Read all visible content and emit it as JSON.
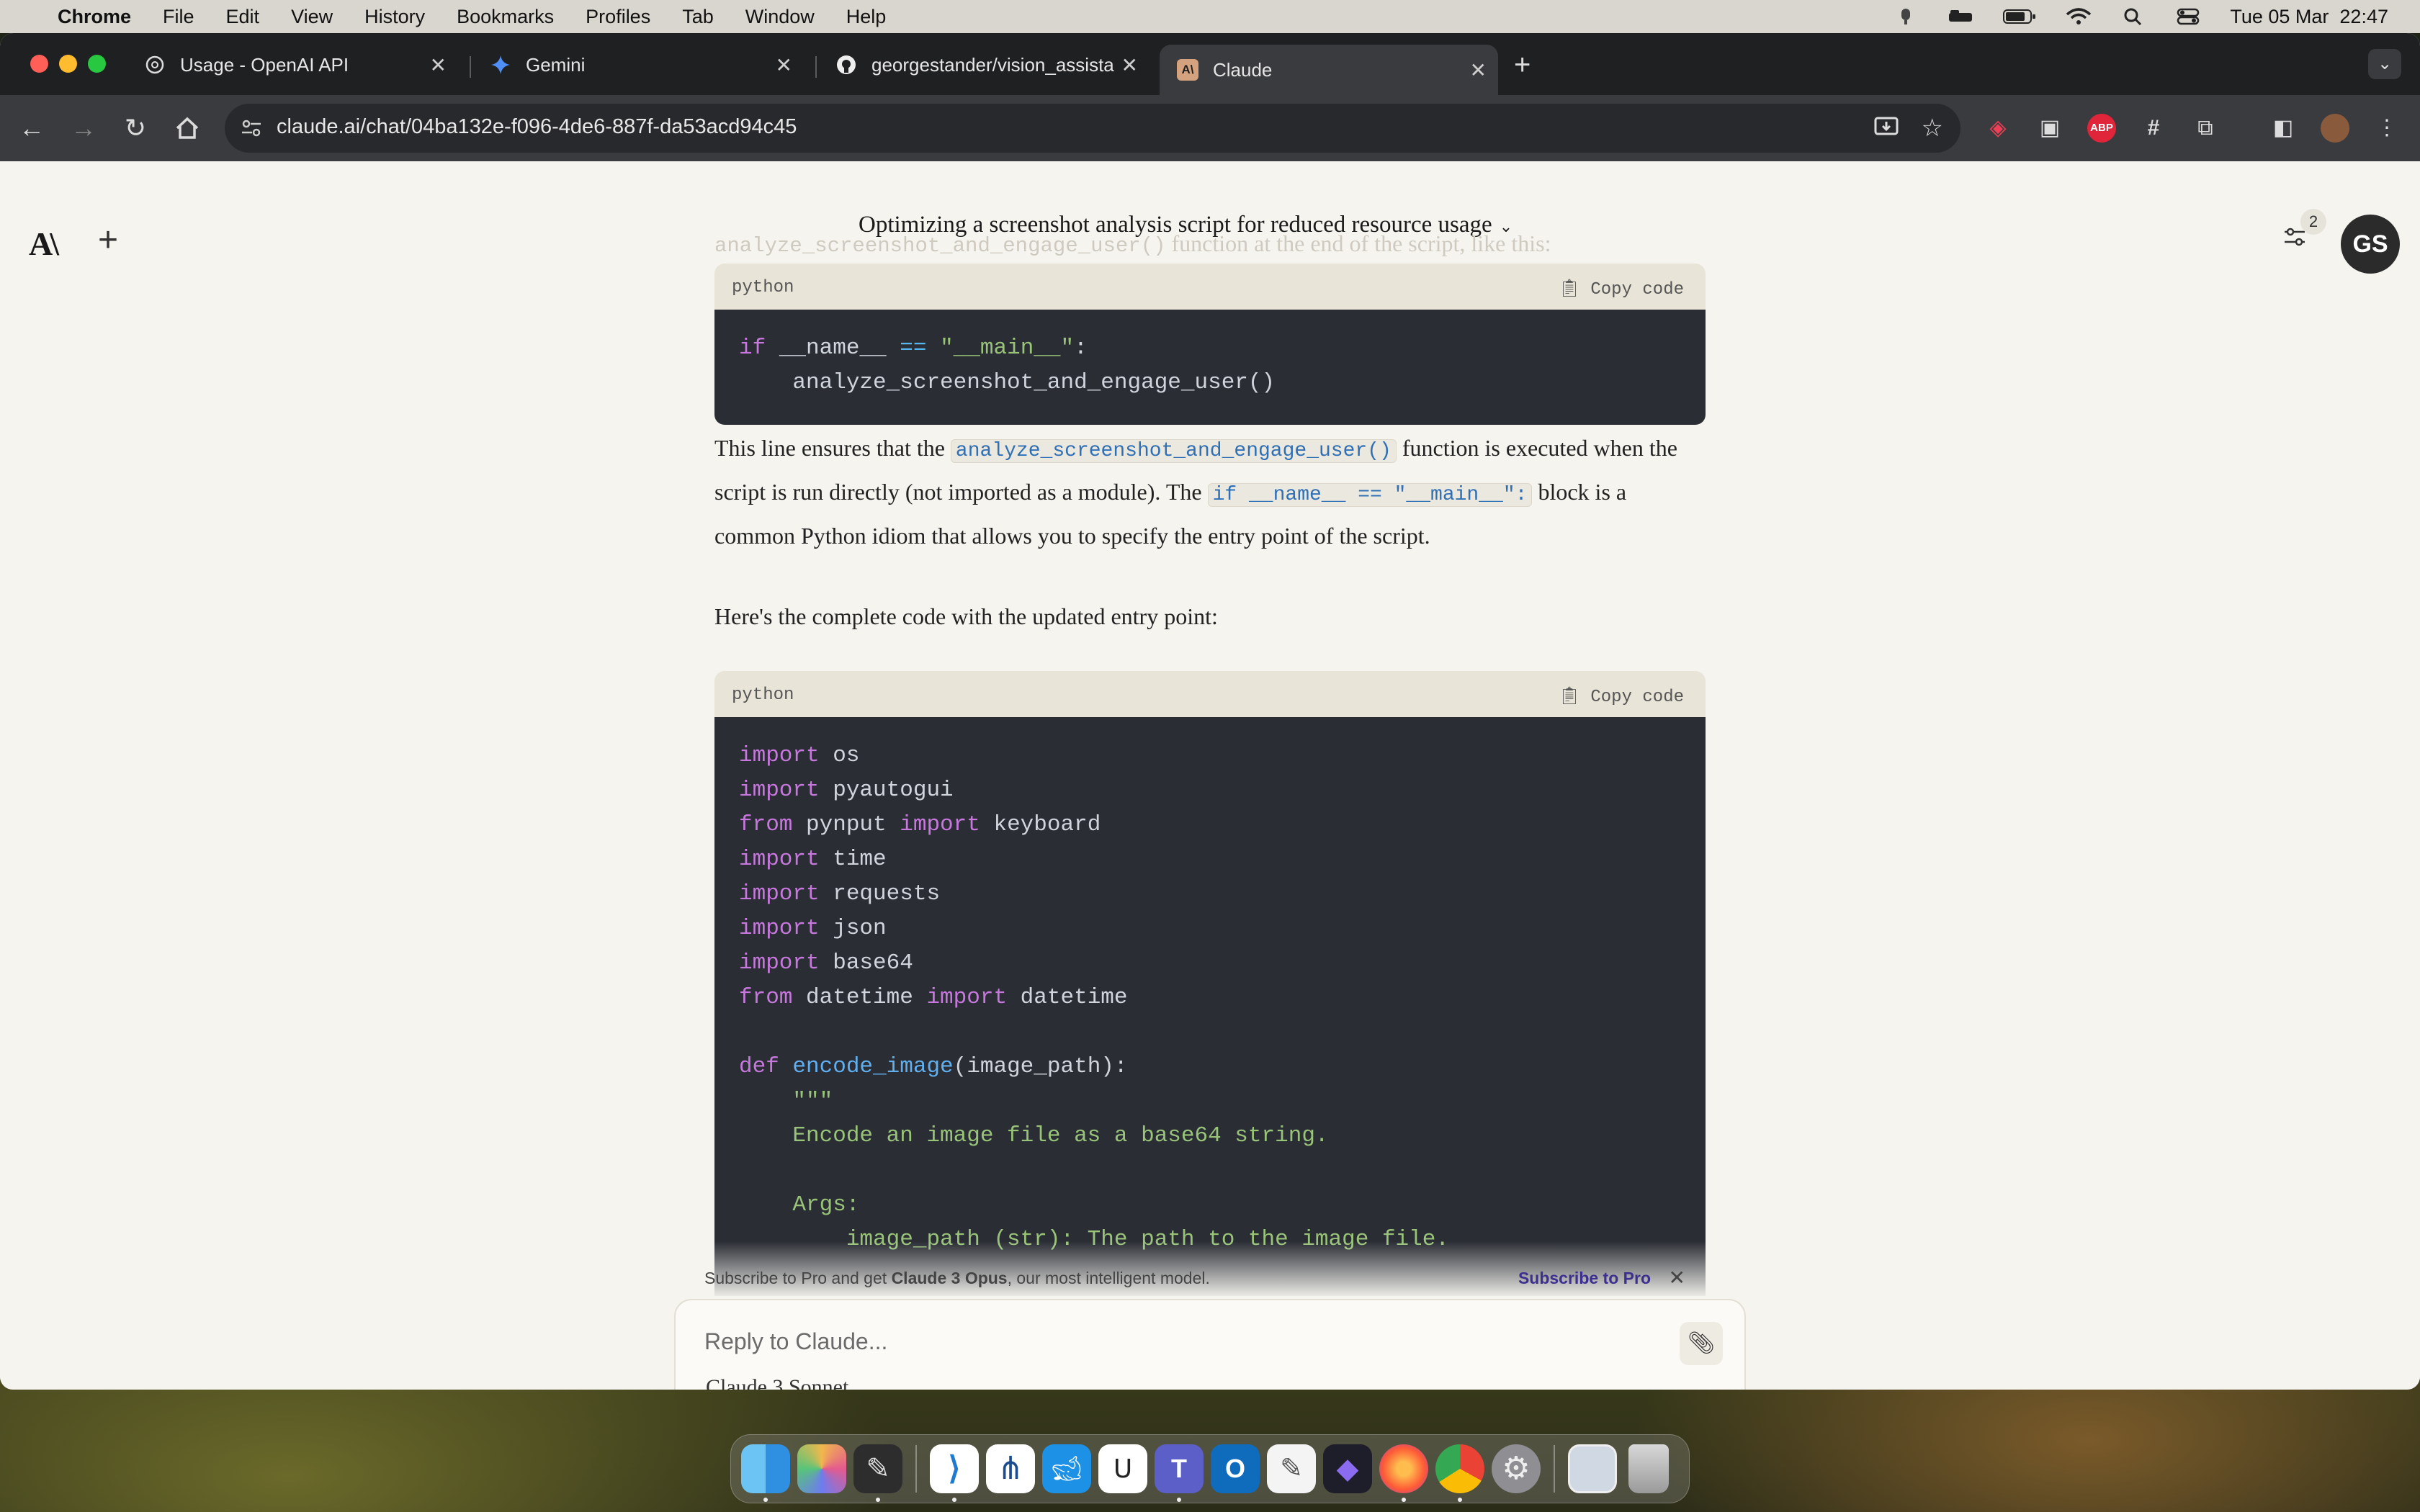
{
  "menubar": {
    "app_name": "Chrome",
    "items": [
      "File",
      "Edit",
      "View",
      "History",
      "Bookmarks",
      "Profiles",
      "Tab",
      "Window",
      "Help"
    ],
    "clock": "Tue 05 Mar  22:47"
  },
  "tabs": [
    {
      "title": "Usage - OpenAI API",
      "icon": "openai-icon",
      "active": false
    },
    {
      "title": "Gemini",
      "icon": "gemini-icon",
      "active": false
    },
    {
      "title": "georgestander/vision_assista",
      "icon": "github-icon",
      "active": false
    },
    {
      "title": "Claude",
      "icon": "claude-icon",
      "active": true
    }
  ],
  "address_bar": {
    "url": "claude.ai/chat/04ba132e-f096-4de6-887f-da53acd94c45"
  },
  "page": {
    "chat_title": "Optimizing a screenshot analysis script for reduced resource usage",
    "notification_count": "2",
    "avatar_initials": "GS",
    "faded_line_code": "analyze_screenshot_and_engage_user()",
    "faded_line_text": " function at the end of the script, like this:",
    "code_block_1": {
      "language": "python",
      "copy_label": "Copy code"
    },
    "para1": {
      "t1": "This line ensures that the ",
      "code1": "analyze_screenshot_and_engage_user()",
      "t2": " function is executed when the script is run directly (not imported as a module). The ",
      "code2": "if __name__ == \"__main__\":",
      "t3": " block is a common Python idiom that allows you to specify the entry point of the script."
    },
    "para2": "Here's the complete code with the updated entry point:",
    "code_block_2": {
      "language": "python",
      "copy_label": "Copy code"
    },
    "promo": {
      "text_pre": "Subscribe to Pro and get ",
      "text_bold": "Claude 3 Opus",
      "text_post": ", our most intelligent model.",
      "link": "Subscribe to Pro"
    },
    "composer": {
      "placeholder": "Reply to Claude...",
      "model": "Claude 3 Sonnet"
    }
  },
  "dock_apps": [
    "Finder",
    "Launchpad",
    "Script Editor",
    "Visual Studio Code",
    "Sourcetree",
    "Docker",
    "Ollama",
    "Microsoft Teams",
    "Microsoft Outlook",
    "TextEdit",
    "Obsidian",
    "Firefox",
    "Google Chrome",
    "System Settings",
    "Preview",
    "Trash"
  ],
  "colors": {
    "accent": "#3b2f8f",
    "code_bg": "#2a2d34",
    "page_bg": "#f5f4ef"
  }
}
